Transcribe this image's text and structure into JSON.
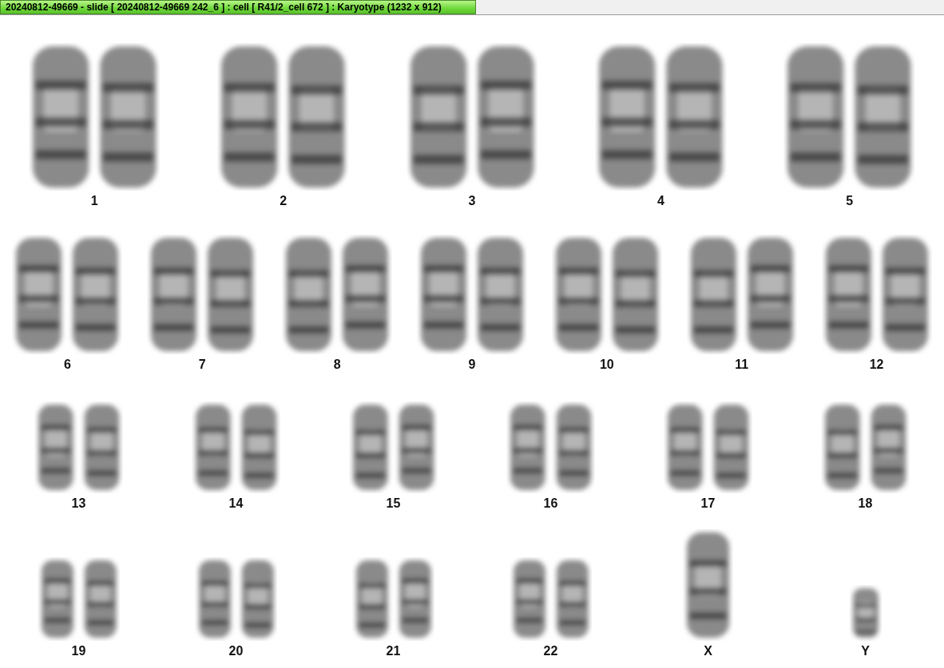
{
  "window": {
    "title": "20240812-49669 - slide [ 20240812-49669 242_6 ] : cell [ R41/2_cell 672 ] : Karyotype  (1232 x 912)"
  },
  "karyotype": {
    "rows": [
      {
        "items": [
          {
            "label": "1",
            "kind": "pair"
          },
          {
            "label": "2",
            "kind": "pair"
          },
          {
            "label": "3",
            "kind": "pair"
          },
          {
            "label": "4",
            "kind": "pair"
          },
          {
            "label": "5",
            "kind": "pair"
          }
        ]
      },
      {
        "items": [
          {
            "label": "6",
            "kind": "pair"
          },
          {
            "label": "7",
            "kind": "pair"
          },
          {
            "label": "8",
            "kind": "pair"
          },
          {
            "label": "9",
            "kind": "pair"
          },
          {
            "label": "10",
            "kind": "pair"
          },
          {
            "label": "11",
            "kind": "pair"
          },
          {
            "label": "12",
            "kind": "pair"
          }
        ]
      },
      {
        "items": [
          {
            "label": "13",
            "kind": "pair"
          },
          {
            "label": "14",
            "kind": "pair"
          },
          {
            "label": "15",
            "kind": "pair"
          },
          {
            "label": "16",
            "kind": "pair"
          },
          {
            "label": "17",
            "kind": "pair"
          },
          {
            "label": "18",
            "kind": "pair"
          }
        ]
      },
      {
        "items": [
          {
            "label": "19",
            "kind": "pair"
          },
          {
            "label": "20",
            "kind": "pair"
          },
          {
            "label": "21",
            "kind": "pair"
          },
          {
            "label": "22",
            "kind": "pair"
          },
          {
            "label": "X",
            "kind": "single"
          },
          {
            "label": "Y",
            "kind": "single"
          }
        ]
      }
    ]
  }
}
